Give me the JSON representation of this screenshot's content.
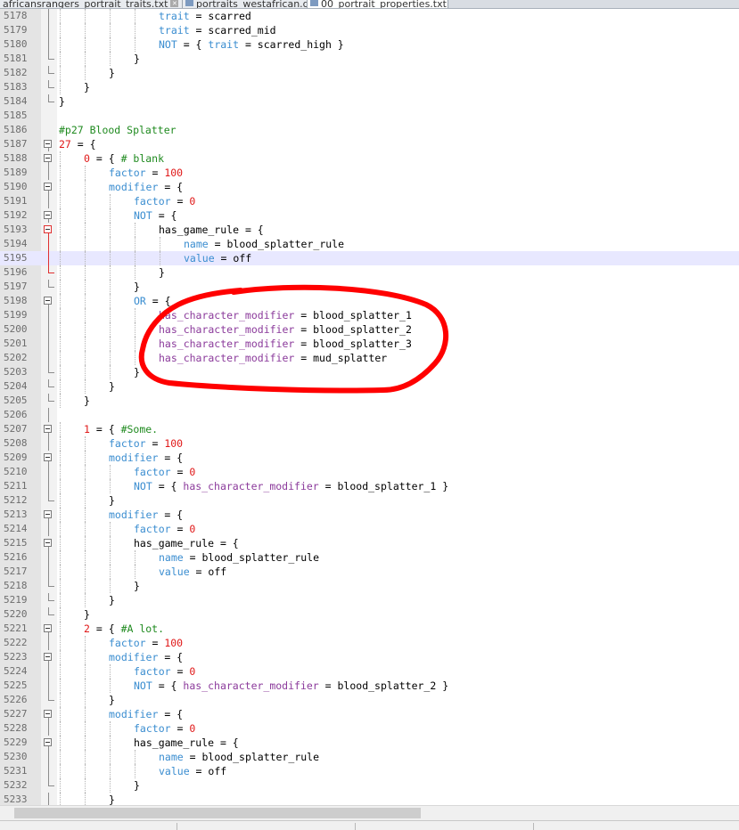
{
  "tabs": [
    {
      "label": "africansrangers_portrait_traits.txt",
      "active": false
    },
    {
      "label": "portraits_westafrican.gfx",
      "active": false
    },
    {
      "label": "00_portrait_properties.txt",
      "active": true
    }
  ],
  "lines": [
    {
      "n": "5178",
      "indent": 4,
      "fold": "line",
      "t": [
        [
          "trait",
          "b"
        ],
        [
          " = scarred",
          "o"
        ]
      ]
    },
    {
      "n": "5179",
      "indent": 4,
      "fold": "line",
      "t": [
        [
          "trait",
          "b"
        ],
        [
          " = scarred_mid",
          "o"
        ]
      ]
    },
    {
      "n": "5180",
      "indent": 4,
      "fold": "line",
      "t": [
        [
          "NOT",
          "b"
        ],
        [
          " = { ",
          "o"
        ],
        [
          "trait",
          "b"
        ],
        [
          " = scarred_high }",
          "o"
        ]
      ]
    },
    {
      "n": "5181",
      "indent": 3,
      "fold": "end",
      "t": [
        [
          "}",
          "o"
        ]
      ]
    },
    {
      "n": "5182",
      "indent": 2,
      "fold": "end",
      "t": [
        [
          "}",
          "o"
        ]
      ]
    },
    {
      "n": "5183",
      "indent": 1,
      "fold": "end",
      "t": [
        [
          "}",
          "o"
        ]
      ]
    },
    {
      "n": "5184",
      "indent": 0,
      "fold": "end",
      "t": [
        [
          "}",
          "o"
        ]
      ]
    },
    {
      "n": "5185",
      "indent": 0,
      "fold": "none",
      "t": []
    },
    {
      "n": "5186",
      "indent": 0,
      "fold": "none",
      "t": [
        [
          "#p27 Blood Splatter",
          "c"
        ]
      ]
    },
    {
      "n": "5187",
      "indent": 0,
      "fold": "box",
      "t": [
        [
          "27",
          "r"
        ],
        [
          " = {",
          "o"
        ]
      ]
    },
    {
      "n": "5188",
      "indent": 1,
      "fold": "box",
      "t": [
        [
          "0",
          "r"
        ],
        [
          " = { ",
          "o"
        ],
        [
          "# blank",
          "c"
        ]
      ]
    },
    {
      "n": "5189",
      "indent": 2,
      "fold": "line",
      "t": [
        [
          "factor",
          "b"
        ],
        [
          " = ",
          "o"
        ],
        [
          "100",
          "r"
        ]
      ]
    },
    {
      "n": "5190",
      "indent": 2,
      "fold": "box",
      "t": [
        [
          "modifier",
          "b"
        ],
        [
          " = {",
          "o"
        ]
      ]
    },
    {
      "n": "5191",
      "indent": 3,
      "fold": "line",
      "t": [
        [
          "factor",
          "b"
        ],
        [
          " = ",
          "o"
        ],
        [
          "0",
          "r"
        ]
      ]
    },
    {
      "n": "5192",
      "indent": 3,
      "fold": "box",
      "t": [
        [
          "NOT",
          "b"
        ],
        [
          " = {",
          "o"
        ]
      ]
    },
    {
      "n": "5193",
      "indent": 4,
      "fold": "boxred",
      "t": [
        [
          "has_game_rule",
          "o"
        ],
        [
          " = {",
          "o"
        ]
      ]
    },
    {
      "n": "5194",
      "indent": 5,
      "fold": "linered",
      "t": [
        [
          "name",
          "b"
        ],
        [
          " = blood_splatter_rule",
          "o"
        ]
      ]
    },
    {
      "n": "5195",
      "indent": 5,
      "fold": "linered",
      "hl": true,
      "t": [
        [
          "value",
          "b"
        ],
        [
          " = off",
          "o"
        ]
      ]
    },
    {
      "n": "5196",
      "indent": 4,
      "fold": "endred",
      "t": [
        [
          "}",
          "o"
        ]
      ]
    },
    {
      "n": "5197",
      "indent": 3,
      "fold": "end",
      "t": [
        [
          "}",
          "o"
        ]
      ]
    },
    {
      "n": "5198",
      "indent": 3,
      "fold": "box",
      "t": [
        [
          "OR",
          "b"
        ],
        [
          " = {",
          "o"
        ]
      ]
    },
    {
      "n": "5199",
      "indent": 4,
      "fold": "line",
      "t": [
        [
          "has_character_modifier",
          "p"
        ],
        [
          " = blood_splatter_1",
          "o"
        ]
      ]
    },
    {
      "n": "5200",
      "indent": 4,
      "fold": "line",
      "t": [
        [
          "has_character_modifier",
          "p"
        ],
        [
          " = blood_splatter_2",
          "o"
        ]
      ]
    },
    {
      "n": "5201",
      "indent": 4,
      "fold": "line",
      "t": [
        [
          "has_character_modifier",
          "p"
        ],
        [
          " = blood_splatter_3",
          "o"
        ]
      ]
    },
    {
      "n": "5202",
      "indent": 4,
      "fold": "line",
      "t": [
        [
          "has_character_modifier",
          "p"
        ],
        [
          " = mud_splatter",
          "o"
        ]
      ]
    },
    {
      "n": "5203",
      "indent": 3,
      "fold": "end",
      "t": [
        [
          "}",
          "o"
        ]
      ]
    },
    {
      "n": "5204",
      "indent": 2,
      "fold": "end",
      "t": [
        [
          "}",
          "o"
        ]
      ]
    },
    {
      "n": "5205",
      "indent": 1,
      "fold": "end",
      "t": [
        [
          "}",
          "o"
        ]
      ]
    },
    {
      "n": "5206",
      "indent": 0,
      "fold": "line",
      "t": []
    },
    {
      "n": "5207",
      "indent": 1,
      "fold": "box",
      "t": [
        [
          "1",
          "r"
        ],
        [
          " = { ",
          "o"
        ],
        [
          "#Some.",
          "c"
        ]
      ]
    },
    {
      "n": "5208",
      "indent": 2,
      "fold": "line",
      "t": [
        [
          "factor",
          "b"
        ],
        [
          " = ",
          "o"
        ],
        [
          "100",
          "r"
        ]
      ]
    },
    {
      "n": "5209",
      "indent": 2,
      "fold": "box",
      "t": [
        [
          "modifier",
          "b"
        ],
        [
          " = {",
          "o"
        ]
      ]
    },
    {
      "n": "5210",
      "indent": 3,
      "fold": "line",
      "t": [
        [
          "factor",
          "b"
        ],
        [
          " = ",
          "o"
        ],
        [
          "0",
          "r"
        ]
      ]
    },
    {
      "n": "5211",
      "indent": 3,
      "fold": "line",
      "t": [
        [
          "NOT",
          "b"
        ],
        [
          " = { ",
          "o"
        ],
        [
          "has_character_modifier",
          "p"
        ],
        [
          " = blood_splatter_1 }",
          "o"
        ]
      ]
    },
    {
      "n": "5212",
      "indent": 2,
      "fold": "end",
      "t": [
        [
          "}",
          "o"
        ]
      ]
    },
    {
      "n": "5213",
      "indent": 2,
      "fold": "box",
      "t": [
        [
          "modifier",
          "b"
        ],
        [
          " = {",
          "o"
        ]
      ]
    },
    {
      "n": "5214",
      "indent": 3,
      "fold": "line",
      "t": [
        [
          "factor",
          "b"
        ],
        [
          " = ",
          "o"
        ],
        [
          "0",
          "r"
        ]
      ]
    },
    {
      "n": "5215",
      "indent": 3,
      "fold": "box",
      "t": [
        [
          "has_game_rule",
          "o"
        ],
        [
          " = {",
          "o"
        ]
      ]
    },
    {
      "n": "5216",
      "indent": 4,
      "fold": "line",
      "t": [
        [
          "name",
          "b"
        ],
        [
          " = blood_splatter_rule",
          "o"
        ]
      ]
    },
    {
      "n": "5217",
      "indent": 4,
      "fold": "line",
      "t": [
        [
          "value",
          "b"
        ],
        [
          " = off",
          "o"
        ]
      ]
    },
    {
      "n": "5218",
      "indent": 3,
      "fold": "end",
      "t": [
        [
          "}",
          "o"
        ]
      ]
    },
    {
      "n": "5219",
      "indent": 2,
      "fold": "end",
      "t": [
        [
          "}",
          "o"
        ]
      ]
    },
    {
      "n": "5220",
      "indent": 1,
      "fold": "end",
      "t": [
        [
          "}",
          "o"
        ]
      ]
    },
    {
      "n": "5221",
      "indent": 1,
      "fold": "box",
      "t": [
        [
          "2",
          "r"
        ],
        [
          " = { ",
          "o"
        ],
        [
          "#A lot.",
          "c"
        ]
      ]
    },
    {
      "n": "5222",
      "indent": 2,
      "fold": "line",
      "t": [
        [
          "factor",
          "b"
        ],
        [
          " = ",
          "o"
        ],
        [
          "100",
          "r"
        ]
      ]
    },
    {
      "n": "5223",
      "indent": 2,
      "fold": "box",
      "t": [
        [
          "modifier",
          "b"
        ],
        [
          " = {",
          "o"
        ]
      ]
    },
    {
      "n": "5224",
      "indent": 3,
      "fold": "line",
      "t": [
        [
          "factor",
          "b"
        ],
        [
          " = ",
          "o"
        ],
        [
          "0",
          "r"
        ]
      ]
    },
    {
      "n": "5225",
      "indent": 3,
      "fold": "line",
      "t": [
        [
          "NOT",
          "b"
        ],
        [
          " = { ",
          "o"
        ],
        [
          "has_character_modifier",
          "p"
        ],
        [
          " = blood_splatter_2 }",
          "o"
        ]
      ]
    },
    {
      "n": "5226",
      "indent": 2,
      "fold": "end",
      "t": [
        [
          "}",
          "o"
        ]
      ]
    },
    {
      "n": "5227",
      "indent": 2,
      "fold": "box",
      "t": [
        [
          "modifier",
          "b"
        ],
        [
          " = {",
          "o"
        ]
      ]
    },
    {
      "n": "5228",
      "indent": 3,
      "fold": "line",
      "t": [
        [
          "factor",
          "b"
        ],
        [
          " = ",
          "o"
        ],
        [
          "0",
          "r"
        ]
      ]
    },
    {
      "n": "5229",
      "indent": 3,
      "fold": "box",
      "t": [
        [
          "has_game_rule",
          "o"
        ],
        [
          " = {",
          "o"
        ]
      ]
    },
    {
      "n": "5230",
      "indent": 4,
      "fold": "line",
      "t": [
        [
          "name",
          "b"
        ],
        [
          " = blood_splatter_rule",
          "o"
        ]
      ]
    },
    {
      "n": "5231",
      "indent": 4,
      "fold": "line",
      "t": [
        [
          "value",
          "b"
        ],
        [
          " = off",
          "o"
        ]
      ]
    },
    {
      "n": "5232",
      "indent": 3,
      "fold": "end",
      "t": [
        [
          "}",
          "o"
        ]
      ]
    },
    {
      "n": "5233",
      "indent": 2,
      "fold": "line",
      "t": [
        [
          "}",
          "o"
        ]
      ]
    }
  ],
  "colors": {
    "keyword_blue": "#3a8dd0",
    "keyword_purple": "#8b3a9b",
    "number_red": "#e01818",
    "comment_green": "#1f8a1f",
    "annotation_red": "#ff0000",
    "current_line": "#e8e8ff"
  },
  "icons": {
    "tab_file": "file-icon",
    "tab_close": "close-icon",
    "fold_marker": "fold-minus-icon"
  }
}
